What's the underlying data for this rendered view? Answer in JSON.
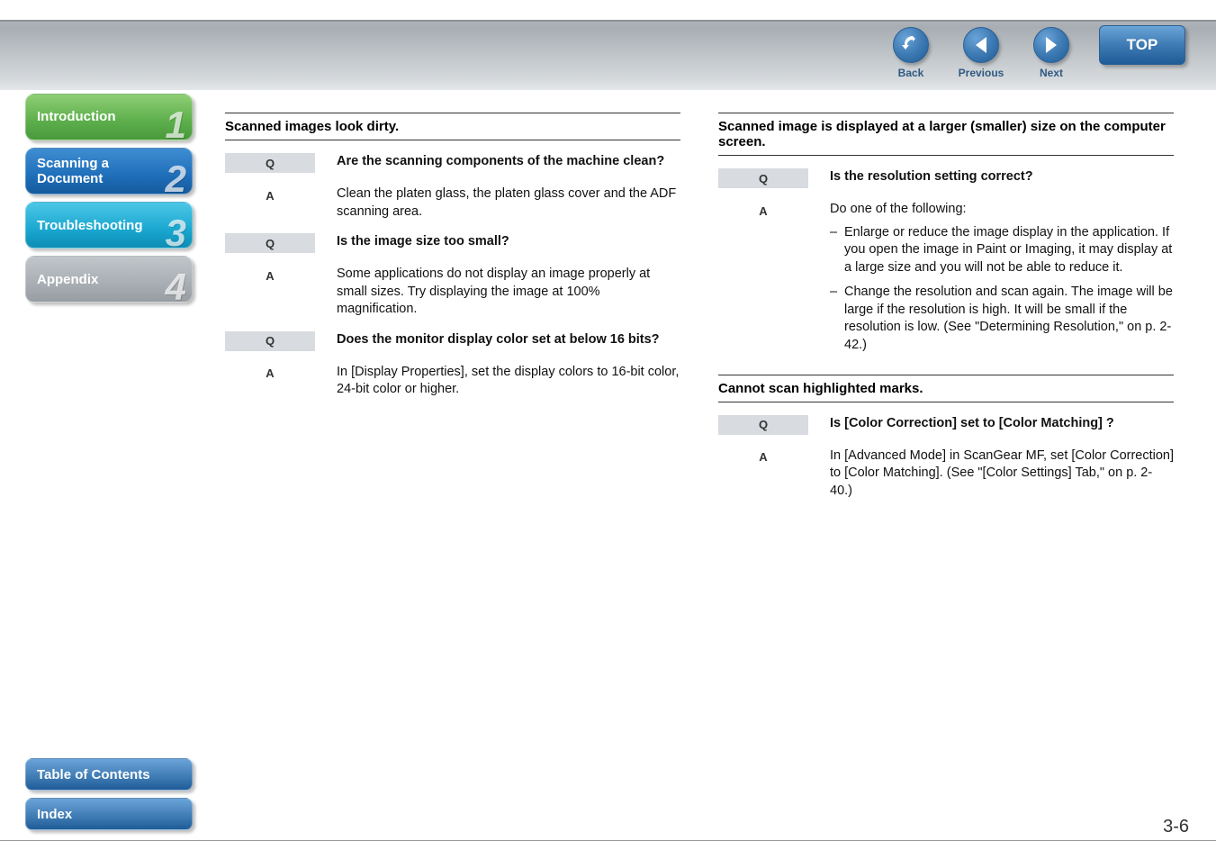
{
  "topnav": {
    "back": "Back",
    "previous": "Previous",
    "next": "Next",
    "top": "TOP"
  },
  "sidebar": {
    "items": [
      {
        "label": "Introduction",
        "num": "1"
      },
      {
        "label": "Scanning a\nDocument",
        "num": "2"
      },
      {
        "label": "Troubleshooting",
        "num": "3"
      },
      {
        "label": "Appendix",
        "num": "4"
      }
    ]
  },
  "bottom": {
    "toc": "Table of Contents",
    "index": "Index"
  },
  "left_col": {
    "title": "Scanned images look dirty.",
    "rows": [
      {
        "type": "Q",
        "text": "Are the scanning components of the machine clean?"
      },
      {
        "type": "A",
        "text": "Clean the platen glass, the platen glass cover and the ADF scanning area."
      },
      {
        "type": "Q",
        "text": "Is the image size too small?"
      },
      {
        "type": "A",
        "text": "Some applications do not display an image properly at small sizes. Try displaying the image at 100% magnification."
      },
      {
        "type": "Q",
        "text": "Does the monitor display color set at below 16 bits?"
      },
      {
        "type": "A",
        "text": "In [Display Properties], set the display colors to 16-bit color, 24-bit color or higher."
      }
    ]
  },
  "right_col": {
    "block1": {
      "title": "Scanned image is displayed at a larger (smaller) size on the computer screen.",
      "q": "Is the resolution setting correct?",
      "a_intro": "Do one of the following:",
      "a_points": [
        "Enlarge or reduce the image display in the application. If you open the image in Paint or Imaging, it may display at a large size and you will not be able to reduce it.",
        "Change the resolution and scan again. The image will be large if the resolution is high. It will be small if the resolution is low. (See \"Determining Resolution,\" on p. 2-42.)"
      ]
    },
    "block2": {
      "title": "Cannot scan highlighted marks.",
      "q": "Is [Color Correction] set to [Color Matching] ?",
      "a": "In [Advanced Mode] in ScanGear MF, set [Color Correction] to [Color Matching]. (See \"[Color Settings] Tab,\" on p. 2-40.)"
    }
  },
  "page_num": "3-6"
}
